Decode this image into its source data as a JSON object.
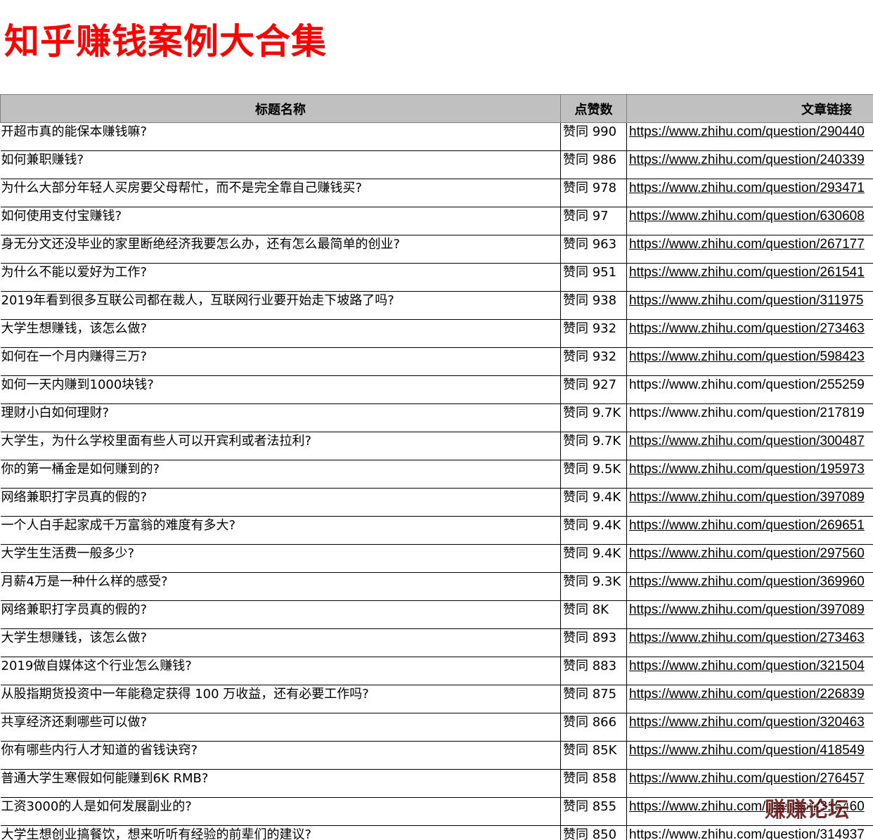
{
  "page": {
    "title": "知乎赚钱案例大合集",
    "title_color": "#ff0000",
    "watermark": "赚赚论坛"
  },
  "table": {
    "headers": {
      "title": "标题名称",
      "likes": "点赞数",
      "link": "文章链接"
    },
    "header_bg": "#c0c0c0",
    "rows": [
      {
        "title": "开超市真的能保本赚钱嘛?",
        "likes": "赞同 990",
        "link": "https://www.zhihu.com/question/290440",
        "underlined": true
      },
      {
        "title": "如何兼职赚钱?",
        "likes": "赞同 986",
        "link": "https://www.zhihu.com/question/240339",
        "underlined": true
      },
      {
        "title": "为什么大部分年轻人买房要父母帮忙，而不是完全靠自己赚钱买?",
        "likes": "赞同 978",
        "link": "https://www.zhihu.com/question/293471",
        "underlined": true
      },
      {
        "title": "如何使用支付宝赚钱?",
        "likes": "赞同 97",
        "link": "https://www.zhihu.com/question/630608",
        "underlined": true
      },
      {
        "title": "身无分文还没毕业的家里断绝经济我要怎么办，还有怎么最简单的创业?",
        "likes": "赞同 963",
        "link": "https://www.zhihu.com/question/267177",
        "underlined": true
      },
      {
        "title": "为什么不能以爱好为工作?",
        "likes": "赞同 951",
        "link": "https://www.zhihu.com/question/261541",
        "underlined": true
      },
      {
        "title": "2019年看到很多互联公司都在裁人，互联网行业要开始走下坡路了吗?",
        "likes": "赞同 938",
        "link": "https://www.zhihu.com/question/311975",
        "underlined": true
      },
      {
        "title": "大学生想赚钱，该怎么做?",
        "likes": "赞同 932",
        "link": "https://www.zhihu.com/question/273463",
        "underlined": true
      },
      {
        "title": "如何在一个月内赚得三万?",
        "likes": "赞同 932",
        "link": "https://www.zhihu.com/question/598423",
        "underlined": true
      },
      {
        "title": "如何一天内赚到1000块钱?",
        "likes": "赞同 927",
        "link": "https://www.zhihu.com/question/255259",
        "underlined": false
      },
      {
        "title": "理财小白如何理财?",
        "likes": "赞同 9.7K",
        "link": "https://www.zhihu.com/question/217819",
        "underlined": false
      },
      {
        "title": "大学生，为什么学校里面有些人可以开宾利或者法拉利?",
        "likes": "赞同 9.7K",
        "link": "https://www.zhihu.com/question/300487",
        "underlined": true
      },
      {
        "title": "你的第一桶金是如何赚到的?",
        "likes": "赞同 9.5K",
        "link": "https://www.zhihu.com/question/195973",
        "underlined": true
      },
      {
        "title": "网络兼职打字员真的假的?",
        "likes": "赞同 9.4K",
        "link": "https://www.zhihu.com/question/397089",
        "underlined": true
      },
      {
        "title": "一个人白手起家成千万富翁的难度有多大?",
        "likes": "赞同 9.4K",
        "link": "https://www.zhihu.com/question/269651",
        "underlined": true
      },
      {
        "title": "大学生生活费一般多少?",
        "likes": "赞同 9.4K",
        "link": "https://www.zhihu.com/question/297560",
        "underlined": true
      },
      {
        "title": "月薪4万是一种什么样的感受?",
        "likes": "赞同 9.3K",
        "link": "https://www.zhihu.com/question/369960",
        "underlined": true
      },
      {
        "title": "网络兼职打字员真的假的?",
        "likes": "赞同 8K",
        "link": "https://www.zhihu.com/question/397089",
        "underlined": true
      },
      {
        "title": "大学生想赚钱，该怎么做?",
        "likes": "赞同 893",
        "link": "https://www.zhihu.com/question/273463",
        "underlined": true
      },
      {
        "title": "2019做自媒体这个行业怎么赚钱?",
        "likes": "赞同 883",
        "link": "https://www.zhihu.com/question/321504",
        "underlined": true
      },
      {
        "title": "从股指期货投资中一年能稳定获得 100 万收益，还有必要工作吗?",
        "likes": "赞同 875",
        "link": "https://www.zhihu.com/question/226839",
        "underlined": true
      },
      {
        "title": "共享经济还剩哪些可以做?",
        "likes": "赞同 866",
        "link": "https://www.zhihu.com/question/320463",
        "underlined": true
      },
      {
        "title": "你有哪些内行人才知道的省钱诀窍?",
        "likes": "赞同 85K",
        "link": "https://www.zhihu.com/question/418549",
        "underlined": true
      },
      {
        "title": "普通大学生寒假如何能赚到6K RMB?",
        "likes": "赞同 858",
        "link": "https://www.zhihu.com/question/276457",
        "underlined": true
      },
      {
        "title": "工资3000的人是如何发展副业的?",
        "likes": "赞同 855",
        "link": "https://www.zhihu.com/question/315460",
        "underlined": true
      },
      {
        "title": "大学生想创业搞餐饮，想来听听有经验的前辈们的建议?",
        "likes": "赞同 850",
        "link": "https://www.zhihu.com/question/314937",
        "underlined": false
      }
    ]
  }
}
